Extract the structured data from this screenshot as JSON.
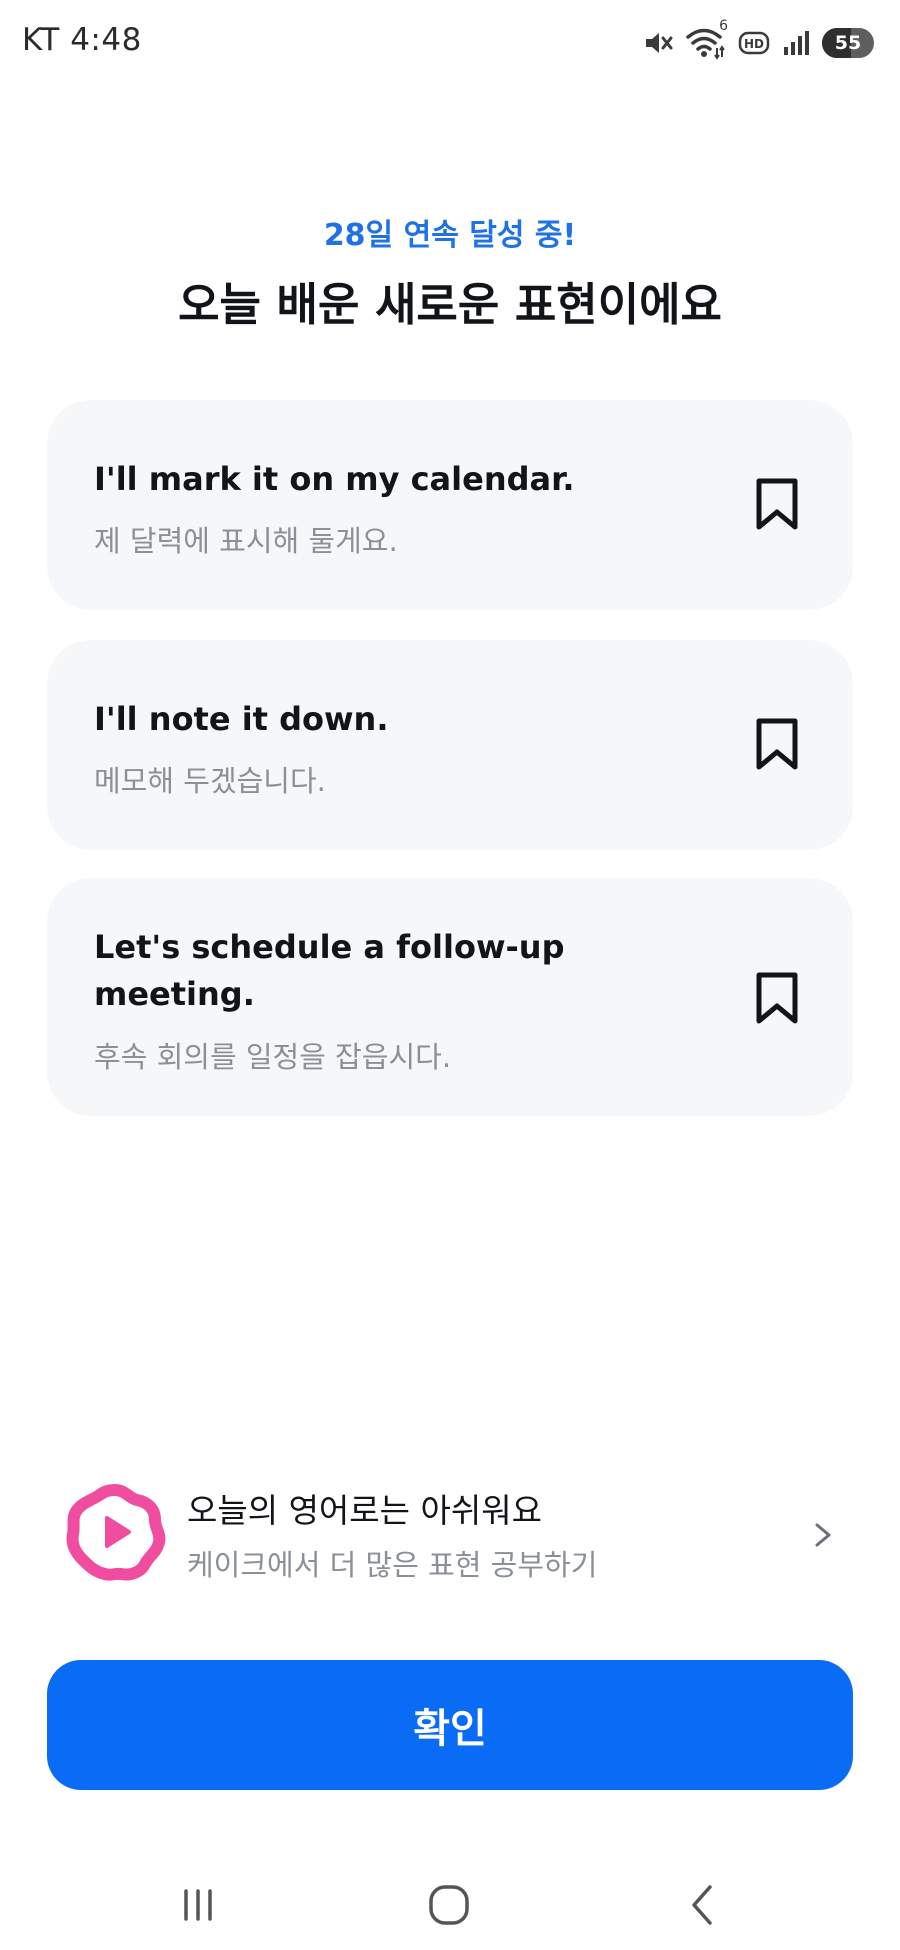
{
  "status_bar": {
    "carrier_time": "KT 4:48",
    "battery_level": "55",
    "battery_fraction": 0.55,
    "icons": [
      "mute-icon",
      "wifi-icon",
      "hd-icon",
      "signal-icon",
      "battery-icon"
    ],
    "wifi_badge": "6"
  },
  "header": {
    "streak": "28일 연속 달성 중!",
    "title": "오늘 배운 새로운 표현이에요"
  },
  "expressions": [
    {
      "en": "I'll mark it on my calendar.",
      "ko": "제 달력에 표시해 둘게요."
    },
    {
      "en": "I'll note it down.",
      "ko": "메모해 두겠습니다."
    },
    {
      "en": "Let's schedule a follow-up meeting.",
      "ko": "후속 회의를 일정을 잡읍시다."
    }
  ],
  "promo": {
    "title": "오늘의 영어로는 아쉬워요",
    "subtitle": "케이크에서 더 많은 표현 공부하기"
  },
  "confirm_label": "확인",
  "colors": {
    "accent": "#0a6cf5",
    "streak": "#1e72e6",
    "card_bg": "#f6f7f9",
    "promo_pink": "#f04da0"
  }
}
